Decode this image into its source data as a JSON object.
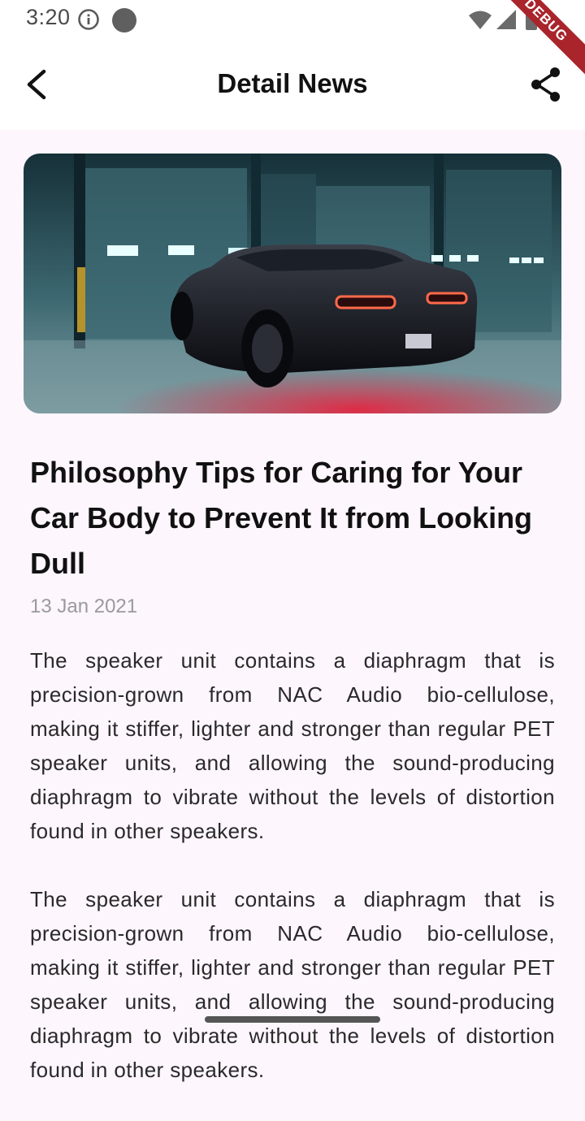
{
  "status_bar": {
    "time": "3:20",
    "debug_label": "DEBUG"
  },
  "app_bar": {
    "title": "Detail News"
  },
  "article": {
    "title": "Philosophy Tips for Caring for Your Car Body to Prevent It from Looking Dull",
    "date": "13 Jan 2021",
    "paragraphs": [
      "The speaker unit contains a diaphragm that is precision-grown from NAC Audio bio-cellulose, making it stiffer, lighter and stronger than regular PET speaker units, and allowing the sound-producing diaphragm to vibrate without the levels of distortion found in other speakers.",
      "The speaker unit contains a diaphragm that is precision-grown from NAC Audio bio-cellulose, making it stiffer, lighter and stronger than regular PET speaker units, and allowing the sound-producing diaphragm to vibrate without the levels of distortion found in other speakers."
    ]
  },
  "icons": {
    "back": "arrow-back-icon",
    "share": "share-icon",
    "info": "info-icon",
    "wifi": "wifi-icon",
    "signal": "signal-icon",
    "battery": "battery-icon"
  }
}
